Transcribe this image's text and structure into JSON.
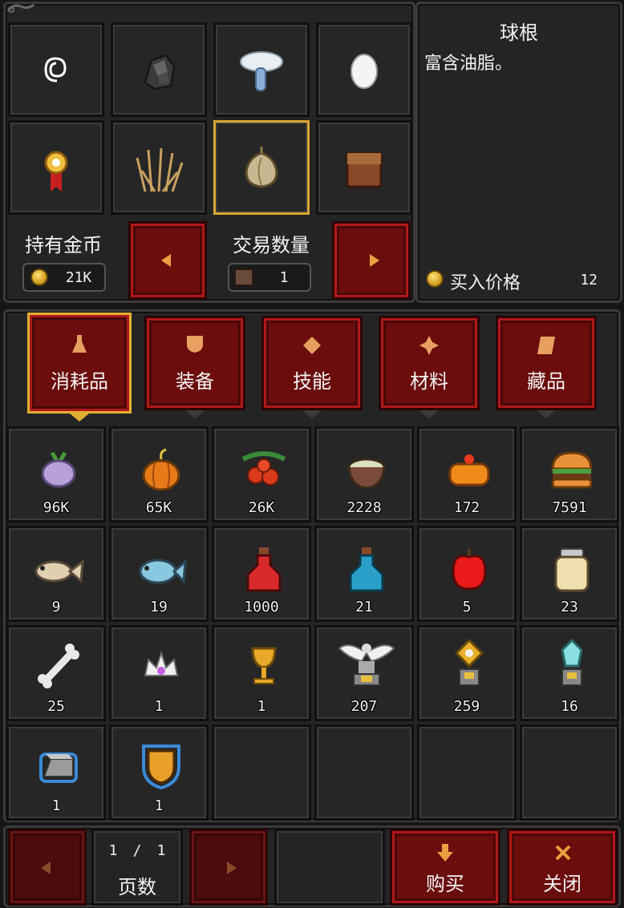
{
  "preview": {
    "item_name": "球根",
    "item_desc": "富含油脂。",
    "price_label": "买入价格",
    "price_value": "12"
  },
  "trade": {
    "gold_label": "持有金币",
    "gold_value": "21K",
    "qty_label": "交易数量",
    "qty_value": "1"
  },
  "top_slots": [
    {
      "icon": "spiral-icon"
    },
    {
      "icon": "coal-ore-icon"
    },
    {
      "icon": "mushroom-icon"
    },
    {
      "icon": "egg-icon"
    },
    {
      "icon": "medal-icon"
    },
    {
      "icon": "dry-grass-icon"
    },
    {
      "icon": "bulb-icon",
      "selected": true
    },
    {
      "icon": "brick-icon"
    }
  ],
  "tabs": [
    {
      "label": "消耗品",
      "active": true
    },
    {
      "label": "装备"
    },
    {
      "label": "技能"
    },
    {
      "label": "材料"
    },
    {
      "label": "藏品"
    }
  ],
  "items": [
    {
      "icon": "turnip-icon",
      "count": "96K"
    },
    {
      "icon": "pumpkin-icon",
      "count": "65K"
    },
    {
      "icon": "berries-icon",
      "count": "26K"
    },
    {
      "icon": "soup-bowl-icon",
      "count": "2228"
    },
    {
      "icon": "cake-icon",
      "count": "172"
    },
    {
      "icon": "burger-icon",
      "count": "7591"
    },
    {
      "icon": "fish-icon",
      "count": "9"
    },
    {
      "icon": "blue-fish-icon",
      "count": "19"
    },
    {
      "icon": "red-potion-icon",
      "count": "1000"
    },
    {
      "icon": "blue-potion-icon",
      "count": "21"
    },
    {
      "icon": "red-apple-icon",
      "count": "5"
    },
    {
      "icon": "jar-icon",
      "count": "23"
    },
    {
      "icon": "bone-icon",
      "count": "25"
    },
    {
      "icon": "tiara-icon",
      "count": "1"
    },
    {
      "icon": "golden-chalice-icon",
      "count": "1"
    },
    {
      "icon": "angel-statue-icon",
      "count": "207"
    },
    {
      "icon": "star-trophy-icon",
      "count": "259"
    },
    {
      "icon": "crystal-trophy-icon",
      "count": "16"
    },
    {
      "icon": "iron-ingot-icon",
      "count": "1"
    },
    {
      "icon": "shield-icon",
      "count": "1"
    }
  ],
  "pager": {
    "current": "1",
    "separator": "/",
    "total": "1",
    "label": "页数"
  },
  "actions": {
    "buy_label": "购买",
    "close_label": "关闭"
  }
}
